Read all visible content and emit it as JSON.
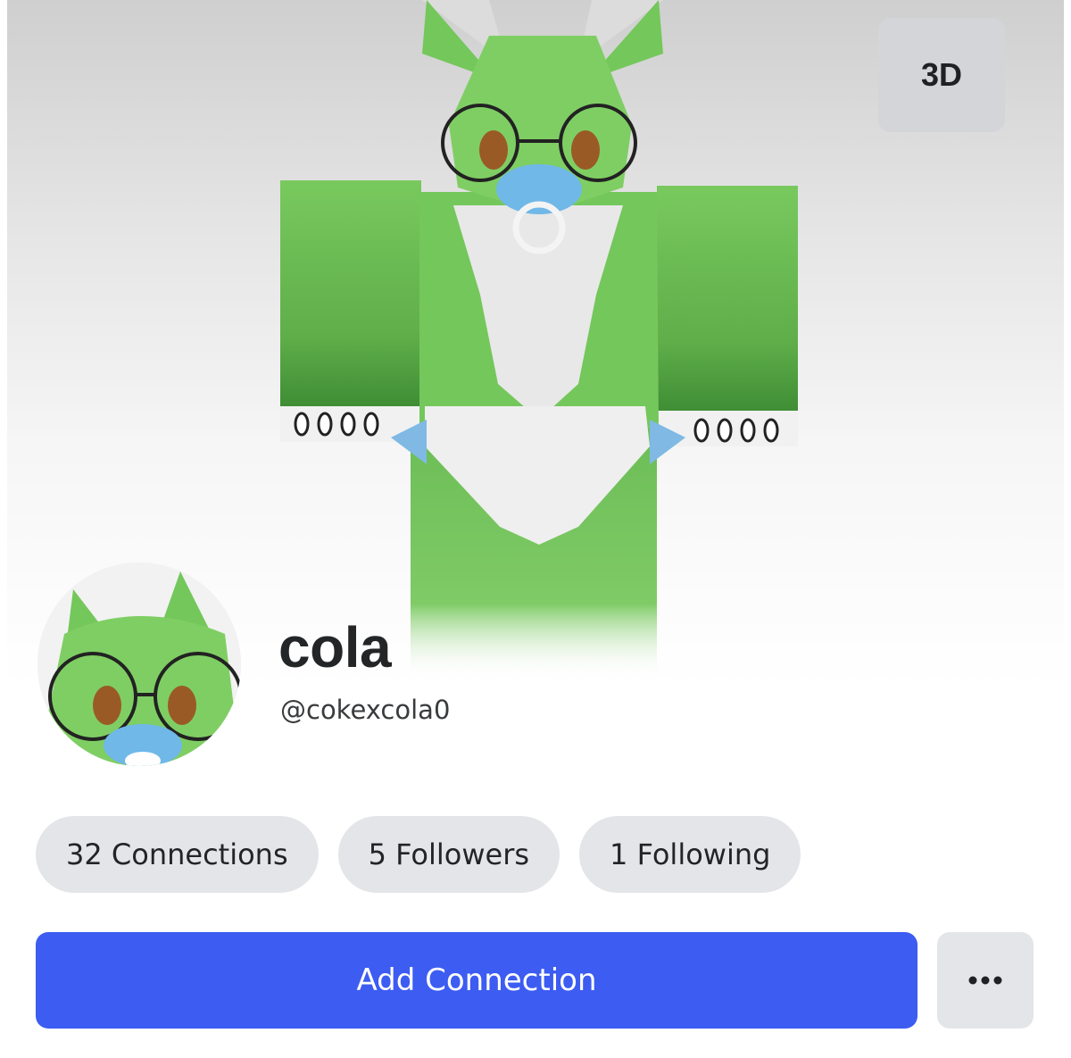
{
  "viewer": {
    "mode_button_label": "3D"
  },
  "profile": {
    "display_name": "cola",
    "username": "@cokexcola0"
  },
  "stats": {
    "connections_label": "32 Connections",
    "followers_label": "5 Followers",
    "following_label": "1 Following"
  },
  "actions": {
    "add_connection_label": "Add Connection",
    "more_icon": "ellipsis-icon"
  },
  "colors": {
    "primary_button": "#3c5cf2",
    "pill_background": "#e4e5e8",
    "avatar_green": "#72c45a",
    "pacifier_blue": "#6fb8e8"
  }
}
